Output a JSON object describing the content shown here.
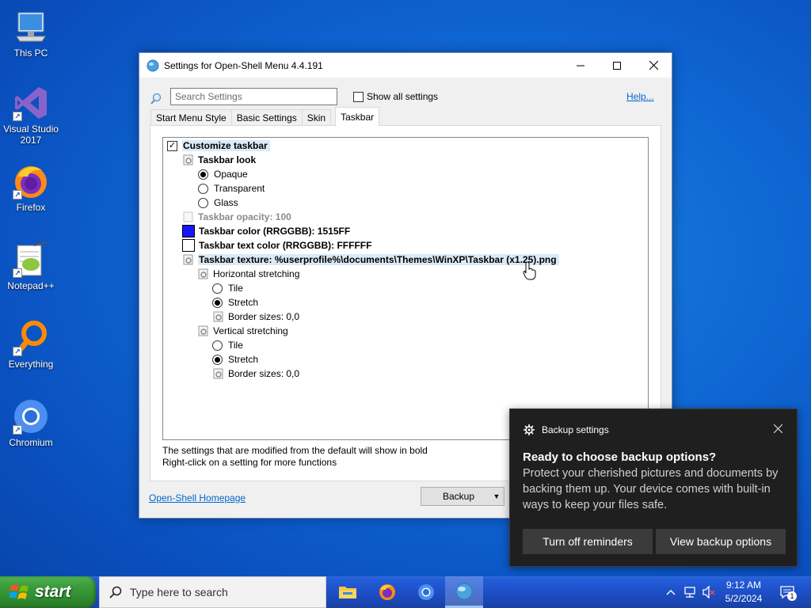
{
  "desktop": {
    "icons": [
      {
        "label": "This PC"
      },
      {
        "label": "Visual Studio 2017"
      },
      {
        "label": "Firefox"
      },
      {
        "label": "Notepad++"
      },
      {
        "label": "Everything"
      },
      {
        "label": "Chromium"
      }
    ]
  },
  "window": {
    "title": "Settings for Open-Shell Menu 4.4.191",
    "search_placeholder": "Search Settings",
    "show_all_label": "Show all settings",
    "help_link": "Help...",
    "tabs": [
      {
        "label": "Start Menu Style",
        "active": false
      },
      {
        "label": "Basic Settings",
        "active": false
      },
      {
        "label": "Skin",
        "active": false
      },
      {
        "label": "Taskbar",
        "active": true
      }
    ],
    "tree": {
      "customize": "Customize taskbar",
      "look": "Taskbar look",
      "opaque": "Opaque",
      "transparent": "Transparent",
      "glass": "Glass",
      "opacity": "Taskbar opacity: 100",
      "color": "Taskbar color (RRGGBB): 1515FF",
      "color_swatch": "#1515FF",
      "text_color": "Taskbar text color (RRGGBB): FFFFFF",
      "text_color_swatch": "#FFFFFF",
      "texture": "Taskbar texture: %userprofile%\\documents\\Themes\\WinXP\\Taskbar (x1.25).png",
      "h_stretch": "Horizontal stretching",
      "h_tile": "Tile",
      "h_stretch_opt": "Stretch",
      "h_border": "Border sizes: 0,0",
      "v_stretch": "Vertical stretching",
      "v_tile": "Tile",
      "v_stretch_opt": "Stretch",
      "v_border": "Border sizes: 0,0"
    },
    "hint1": "The settings that are modified from the default will show in bold",
    "hint2": "Right-click on a setting for more functions",
    "homepage_link": "Open-Shell Homepage",
    "backup_button": "Backup"
  },
  "toast": {
    "app_name": "Backup settings",
    "title": "Ready to choose backup options?",
    "body": "Protect your cherished pictures and documents by backing them up. Your device comes with built-in ways to keep your files safe.",
    "button1": "Turn off reminders",
    "button2": "View backup options"
  },
  "taskbar": {
    "start_label": "start",
    "search_placeholder": "Type here to search",
    "time": "9:12 AM",
    "date": "5/2/2024",
    "notification_count": "1"
  }
}
